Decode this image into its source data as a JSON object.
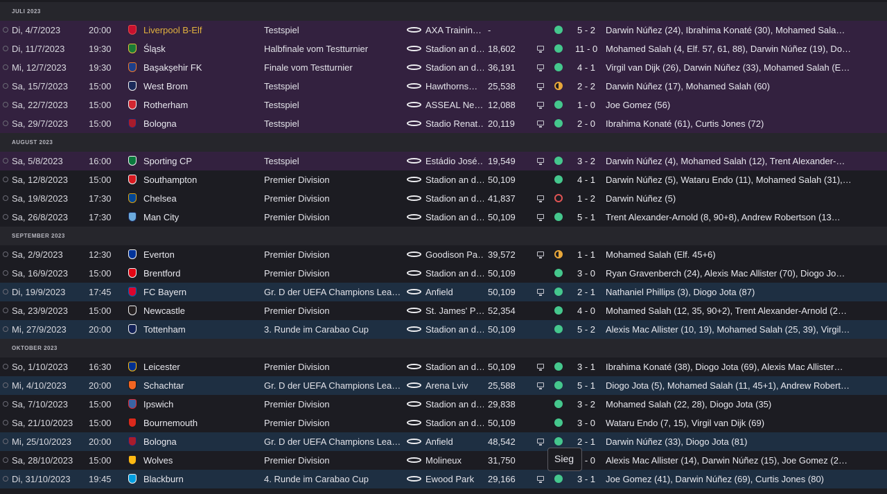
{
  "tooltip": "Sieg",
  "colors": {
    "friendly_row": "#33213f",
    "cup_row": "#1e2f42",
    "league_row": "#1c1c22",
    "win": "#45c78d",
    "draw": "#e8a73a",
    "loss": "#e05454",
    "highlight_team": "#e2b23e"
  },
  "sections": [
    {
      "title": "JULI 2023",
      "matches": [
        {
          "type": "pre",
          "date": "Di, 4/7/2023",
          "time": "20:00",
          "opponent": "Liverpool B-Elf",
          "badge": [
            "#c8102e",
            "#e24b4b"
          ],
          "highlight": true,
          "competition": "Testspiel",
          "venue": "AXA Trainin…",
          "attendance": "-",
          "tv": false,
          "result": "win",
          "score": "5 - 2",
          "scorers": "Darwin Núñez (24), Ibrahima Konaté (30), Mohamed Sala…"
        },
        {
          "type": "pre",
          "date": "Di, 11/7/2023",
          "time": "19:30",
          "opponent": "Śląsk",
          "badge": [
            "#1a7a35",
            "#e0c23a"
          ],
          "highlight": false,
          "competition": "Halbfinale vom Testturnier",
          "venue": "Stadion an d…",
          "attendance": "18,602",
          "tv": true,
          "result": "win",
          "score": "11 - 0",
          "scorers": "Mohamed Salah (4, Elf. 57, 61, 88), Darwin Núñez (19), Do…"
        },
        {
          "type": "pre",
          "date": "Mi, 12/7/2023",
          "time": "19:30",
          "opponent": "Başakşehir FK",
          "badge": [
            "#1d3f8a",
            "#f07a2a"
          ],
          "highlight": false,
          "competition": "Finale vom Testturnier",
          "venue": "Stadion an d…",
          "attendance": "36,191",
          "tv": true,
          "result": "win",
          "score": "4 - 1",
          "scorers": "Virgil van Dijk (26), Darwin Núñez (33), Mohamed Salah (E…"
        },
        {
          "type": "pre",
          "date": "Sa, 15/7/2023",
          "time": "15:00",
          "opponent": "West Brom",
          "badge": [
            "#1b2a5a",
            "#f2f2f2"
          ],
          "highlight": false,
          "competition": "Testspiel",
          "venue": "Hawthorns…",
          "attendance": "25,538",
          "tv": true,
          "result": "draw",
          "score": "2 - 2",
          "scorers": "Darwin Núñez (17), Mohamed Salah (60)"
        },
        {
          "type": "pre",
          "date": "Sa, 22/7/2023",
          "time": "15:00",
          "opponent": "Rotherham",
          "badge": [
            "#d22630",
            "#f2f2f2"
          ],
          "highlight": false,
          "competition": "Testspiel",
          "venue": "ASSEAL Ne…",
          "attendance": "12,088",
          "tv": true,
          "result": "win",
          "score": "1 - 0",
          "scorers": "Joe Gomez (56)"
        },
        {
          "type": "pre",
          "date": "Sa, 29/7/2023",
          "time": "15:00",
          "opponent": "Bologna",
          "badge": [
            "#a81c2c",
            "#1a2a6c"
          ],
          "highlight": false,
          "competition": "Testspiel",
          "venue": "Stadio Renat…",
          "attendance": "20,119",
          "tv": true,
          "result": "win",
          "score": "2 - 0",
          "scorers": "Ibrahima Konaté (61), Curtis Jones (72)"
        }
      ]
    },
    {
      "title": "AUGUST 2023",
      "matches": [
        {
          "type": "pre",
          "date": "Sa, 5/8/2023",
          "time": "16:00",
          "opponent": "Sporting CP",
          "badge": [
            "#0b7a3e",
            "#f2f2f2"
          ],
          "highlight": false,
          "competition": "Testspiel",
          "venue": "Estádio José…",
          "attendance": "19,549",
          "tv": true,
          "result": "win",
          "score": "3 - 2",
          "scorers": "Darwin Núñez (4), Mohamed Salah (12), Trent Alexander-…"
        },
        {
          "type": "lg",
          "date": "Sa, 12/8/2023",
          "time": "15:00",
          "opponent": "Southampton",
          "badge": [
            "#d71920",
            "#f2f2f2"
          ],
          "highlight": false,
          "competition": "Premier Division",
          "venue": "Stadion an d…",
          "attendance": "50,109",
          "tv": false,
          "result": "win",
          "score": "4 - 1",
          "scorers": "Darwin Núñez (5), Wataru Endo (11), Mohamed Salah (31),…"
        },
        {
          "type": "lg",
          "date": "Sa, 19/8/2023",
          "time": "17:30",
          "opponent": "Chelsea",
          "badge": [
            "#034694",
            "#dba111"
          ],
          "highlight": false,
          "competition": "Premier Division",
          "venue": "Stadion an d…",
          "attendance": "41,837",
          "tv": true,
          "result": "loss",
          "score": "1 - 2",
          "scorers": "Darwin Núñez (5)"
        },
        {
          "type": "lg",
          "date": "Sa, 26/8/2023",
          "time": "17:30",
          "opponent": "Man City",
          "badge": [
            "#6cabdd",
            "#1c2c5b"
          ],
          "highlight": false,
          "competition": "Premier Division",
          "venue": "Stadion an d…",
          "attendance": "50,109",
          "tv": true,
          "result": "win",
          "score": "5 - 1",
          "scorers": "Trent Alexander-Arnold (8, 90+8), Andrew Robertson (13…"
        }
      ]
    },
    {
      "title": "SEPTEMBER 2023",
      "matches": [
        {
          "type": "lg",
          "date": "Sa, 2/9/2023",
          "time": "12:30",
          "opponent": "Everton",
          "badge": [
            "#003399",
            "#f2f2f2"
          ],
          "highlight": false,
          "competition": "Premier Division",
          "venue": "Goodison Pa…",
          "attendance": "39,572",
          "tv": true,
          "result": "draw",
          "score": "1 - 1",
          "scorers": "Mohamed Salah (Elf. 45+6)"
        },
        {
          "type": "lg",
          "date": "Sa, 16/9/2023",
          "time": "15:00",
          "opponent": "Brentford",
          "badge": [
            "#e30613",
            "#f2f2f2"
          ],
          "highlight": false,
          "competition": "Premier Division",
          "venue": "Stadion an d…",
          "attendance": "50,109",
          "tv": false,
          "result": "win",
          "score": "3 - 0",
          "scorers": "Ryan Gravenberch (24), Alexis Mac Allister (70), Diogo Jo…"
        },
        {
          "type": "cl",
          "date": "Di, 19/9/2023",
          "time": "17:45",
          "opponent": "FC Bayern",
          "badge": [
            "#dc052d",
            "#0066b2"
          ],
          "highlight": false,
          "competition": "Gr. D der UEFA Champions Lea…",
          "venue": "Anfield",
          "attendance": "50,109",
          "tv": true,
          "result": "win",
          "score": "2 - 1",
          "scorers": "Nathaniel Phillips (3), Diogo Jota (87)"
        },
        {
          "type": "lg",
          "date": "Sa, 23/9/2023",
          "time": "15:00",
          "opponent": "Newcastle",
          "badge": [
            "#241f20",
            "#f2f2f2"
          ],
          "highlight": false,
          "competition": "Premier Division",
          "venue": "St. James' P…",
          "attendance": "52,354",
          "tv": false,
          "result": "win",
          "score": "4 - 0",
          "scorers": "Mohamed Salah (12, 35, 90+2), Trent Alexander-Arnold (2…"
        },
        {
          "type": "cl",
          "date": "Mi, 27/9/2023",
          "time": "20:00",
          "opponent": "Tottenham",
          "badge": [
            "#132257",
            "#f2f2f2"
          ],
          "highlight": false,
          "competition": "3. Runde im Carabao Cup",
          "venue": "Stadion an d…",
          "attendance": "50,109",
          "tv": false,
          "result": "win",
          "score": "5 - 2",
          "scorers": "Alexis Mac Allister (10, 19), Mohamed Salah (25, 39), Virgil…"
        }
      ]
    },
    {
      "title": "OKTOBER 2023",
      "matches": [
        {
          "type": "lg",
          "date": "So, 1/10/2023",
          "time": "16:30",
          "opponent": "Leicester",
          "badge": [
            "#003090",
            "#fdbe11"
          ],
          "highlight": false,
          "competition": "Premier Division",
          "venue": "Stadion an d…",
          "attendance": "50,109",
          "tv": true,
          "result": "win",
          "score": "3 - 1",
          "scorers": "Ibrahima Konaté (38), Diogo Jota (69), Alexis Mac Allister…"
        },
        {
          "type": "cl",
          "date": "Mi, 4/10/2023",
          "time": "20:00",
          "opponent": "Schachtar",
          "badge": [
            "#f26522",
            "#1a1a1a"
          ],
          "highlight": false,
          "competition": "Gr. D der UEFA Champions Lea…",
          "venue": "Arena Lviv",
          "attendance": "25,588",
          "tv": true,
          "result": "win",
          "score": "5 - 1",
          "scorers": "Diogo Jota (5), Mohamed Salah (11, 45+1), Andrew Robert…"
        },
        {
          "type": "lg",
          "date": "Sa, 7/10/2023",
          "time": "15:00",
          "opponent": "Ipswich",
          "badge": [
            "#3a64a3",
            "#de2c37"
          ],
          "highlight": false,
          "competition": "Premier Division",
          "venue": "Stadion an d…",
          "attendance": "29,838",
          "tv": false,
          "result": "win",
          "score": "3 - 2",
          "scorers": "Mohamed Salah (22, 28), Diogo Jota (35)"
        },
        {
          "type": "lg",
          "date": "Sa, 21/10/2023",
          "time": "15:00",
          "opponent": "Bournemouth",
          "badge": [
            "#da291c",
            "#1a1a1a"
          ],
          "highlight": false,
          "competition": "Premier Division",
          "venue": "Stadion an d…",
          "attendance": "50,109",
          "tv": false,
          "result": "win",
          "score": "3 - 0",
          "scorers": "Wataru Endo (7, 15), Virgil van Dijk (69)"
        },
        {
          "type": "cl",
          "date": "Mi, 25/10/2023",
          "time": "20:00",
          "opponent": "Bologna",
          "badge": [
            "#a81c2c",
            "#1a2a6c"
          ],
          "highlight": false,
          "competition": "Gr. D der UEFA Champions Lea…",
          "venue": "Anfield",
          "attendance": "48,542",
          "tv": true,
          "result": "win",
          "score": "2 - 1",
          "scorers": "Darwin Núñez (33), Diogo Jota (81)"
        },
        {
          "type": "lg",
          "date": "Sa, 28/10/2023",
          "time": "15:00",
          "opponent": "Wolves",
          "badge": [
            "#fdb913",
            "#231f20"
          ],
          "highlight": false,
          "competition": "Premier Division",
          "venue": "Molineux",
          "attendance": "31,750",
          "tv": false,
          "result": "win",
          "score": "4 - 0",
          "scorers": "Alexis Mac Allister (14), Darwin Núñez (15), Joe Gomez (2…"
        },
        {
          "type": "cl",
          "date": "Di, 31/10/2023",
          "time": "19:45",
          "opponent": "Blackburn",
          "badge": [
            "#009ee0",
            "#f2f2f2"
          ],
          "highlight": false,
          "competition": "4. Runde im Carabao Cup",
          "venue": "Ewood Park",
          "attendance": "29,166",
          "tv": true,
          "result": "win",
          "score": "3 - 1",
          "scorers": "Joe Gomez (41), Darwin Núñez (69), Curtis Jones (80)"
        }
      ]
    }
  ]
}
